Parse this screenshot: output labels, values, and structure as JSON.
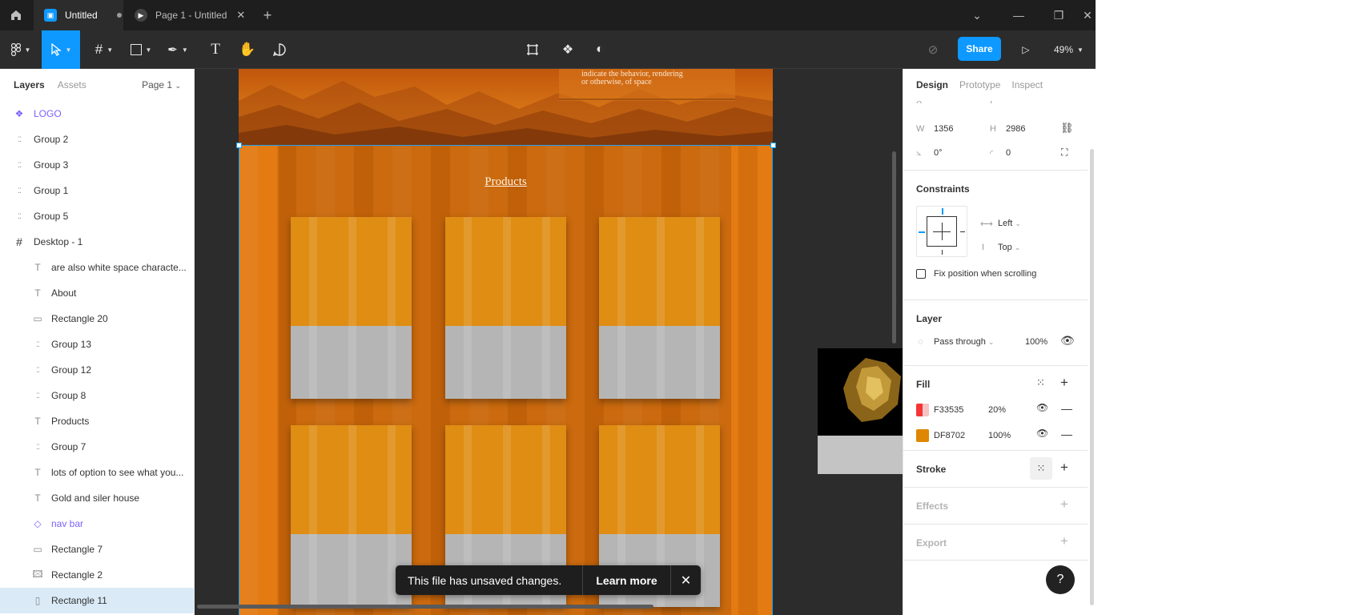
{
  "titlebar": {
    "tabs": [
      {
        "label": "Untitled",
        "active": true
      },
      {
        "label": "Page 1 - Untitled",
        "active": false
      }
    ],
    "icons": [
      "home-icon",
      "figma-file-icon",
      "play-icon",
      "close-icon",
      "plus-icon",
      "chevron-down-icon",
      "minimize-icon",
      "restore-icon",
      "close-window-icon"
    ]
  },
  "toolbar": {
    "share_label": "Share",
    "zoom_label": "49%",
    "tools": [
      "main-menu",
      "move",
      "frame",
      "shape",
      "pen",
      "text",
      "hand",
      "comment"
    ],
    "center_tools": [
      "crop",
      "components",
      "mask"
    ]
  },
  "left_panel": {
    "tabs": {
      "layers": "Layers",
      "assets": "Assets"
    },
    "page_selector": "Page 1",
    "layers": [
      {
        "name": "LOGO",
        "type": "component",
        "indent": 0
      },
      {
        "name": "Group 2",
        "type": "group",
        "indent": 0
      },
      {
        "name": "Group 3",
        "type": "group",
        "indent": 0
      },
      {
        "name": "Group 1",
        "type": "group",
        "indent": 0
      },
      {
        "name": "Group 5",
        "type": "group",
        "indent": 0
      },
      {
        "name": "Desktop - 1",
        "type": "frame",
        "indent": 0
      },
      {
        "name": "are also white space characte...",
        "type": "text",
        "indent": 1
      },
      {
        "name": "About",
        "type": "text",
        "indent": 1
      },
      {
        "name": "Rectangle 20",
        "type": "rectangle",
        "indent": 1
      },
      {
        "name": "Group 13",
        "type": "group",
        "indent": 1
      },
      {
        "name": "Group 12",
        "type": "group",
        "indent": 1
      },
      {
        "name": "Group 8",
        "type": "group",
        "indent": 1
      },
      {
        "name": "Products",
        "type": "text",
        "indent": 1
      },
      {
        "name": "Group 7",
        "type": "group",
        "indent": 1
      },
      {
        "name": "lots of option to see what you...",
        "type": "text",
        "indent": 1
      },
      {
        "name": "Gold and siler house",
        "type": "text",
        "indent": 1
      },
      {
        "name": "nav bar",
        "type": "instance",
        "indent": 1
      },
      {
        "name": "Rectangle 7",
        "type": "rectangle",
        "indent": 1
      },
      {
        "name": "Rectangle 2",
        "type": "image",
        "indent": 1
      },
      {
        "name": "Rectangle 11",
        "type": "rectangle-selected",
        "indent": 1
      }
    ]
  },
  "canvas": {
    "top_text_line1": "indicate the behavior, rendering",
    "top_text_line2": "or otherwise, of space",
    "products_heading": "Products",
    "product_card_count": 6,
    "colors": {
      "frame": "#E37A12",
      "card_top": "#DF8D13",
      "card_bottom": "#B5B5B5",
      "selection": "#18A0FB"
    }
  },
  "toast": {
    "message": "This file has unsaved changes.",
    "learn_more": "Learn more"
  },
  "right_panel": {
    "tabs": {
      "design": "Design",
      "prototype": "Prototype",
      "inspect": "Inspect"
    },
    "w_label": "W",
    "w_value": "1356",
    "h_label": "H",
    "h_value": "2986",
    "rotation": "0°",
    "corner_radius": "0",
    "constraints": {
      "title": "Constraints",
      "horizontal": "Left",
      "vertical": "Top",
      "fix_position": "Fix position when scrolling"
    },
    "layer": {
      "title": "Layer",
      "blend": "Pass through",
      "opacity": "100%"
    },
    "fill": {
      "title": "Fill",
      "items": [
        {
          "hex": "F33535",
          "opacity": "20%",
          "color": "#F33535"
        },
        {
          "hex": "DF8702",
          "opacity": "100%",
          "color": "#DF8702"
        }
      ]
    },
    "stroke": {
      "title": "Stroke"
    },
    "effects": {
      "title": "Effects"
    },
    "export": {
      "title": "Export"
    },
    "help": "?"
  }
}
